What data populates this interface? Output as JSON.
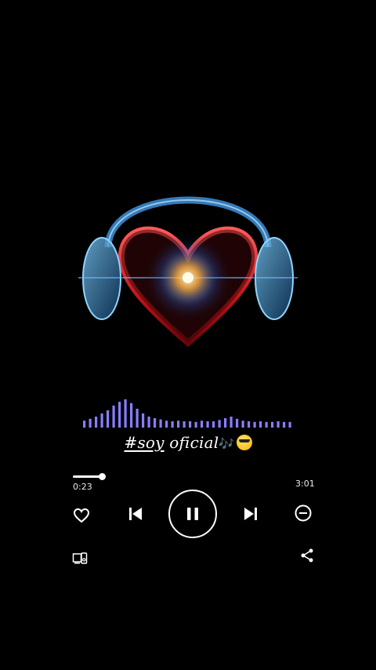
{
  "track": {
    "title_tag": "#soy",
    "title_rest": " oficial",
    "title_emoji_note": "🎶",
    "emoji_name": "smiling-face-with-sunglasses"
  },
  "player": {
    "elapsed": "0:23",
    "duration": "3:01",
    "progress_fraction": 0.127,
    "state": "playing"
  },
  "visualizer": {
    "levels": [
      0.22,
      0.28,
      0.35,
      0.45,
      0.55,
      0.7,
      0.82,
      0.9,
      0.78,
      0.6,
      0.45,
      0.35,
      0.3,
      0.26,
      0.22,
      0.2,
      0.22,
      0.2,
      0.2,
      0.18,
      0.22,
      0.2,
      0.2,
      0.24,
      0.3,
      0.35,
      0.28,
      0.22,
      0.2,
      0.18,
      0.2,
      0.18,
      0.18,
      0.2,
      0.18,
      0.18
    ],
    "color": "#8a7dff"
  },
  "icons": {
    "like": "heart-outline-icon",
    "previous": "skip-previous-icon",
    "pause": "pause-icon",
    "next": "skip-next-icon",
    "remove": "minus-circle-icon",
    "devices": "connect-device-icon",
    "share": "share-icon"
  },
  "colors": {
    "background": "#000000",
    "foreground": "#ffffff",
    "artwork_heart": "#e0242c",
    "artwork_headphones": "#4aa8ff",
    "artwork_glow": "#ffb347"
  }
}
